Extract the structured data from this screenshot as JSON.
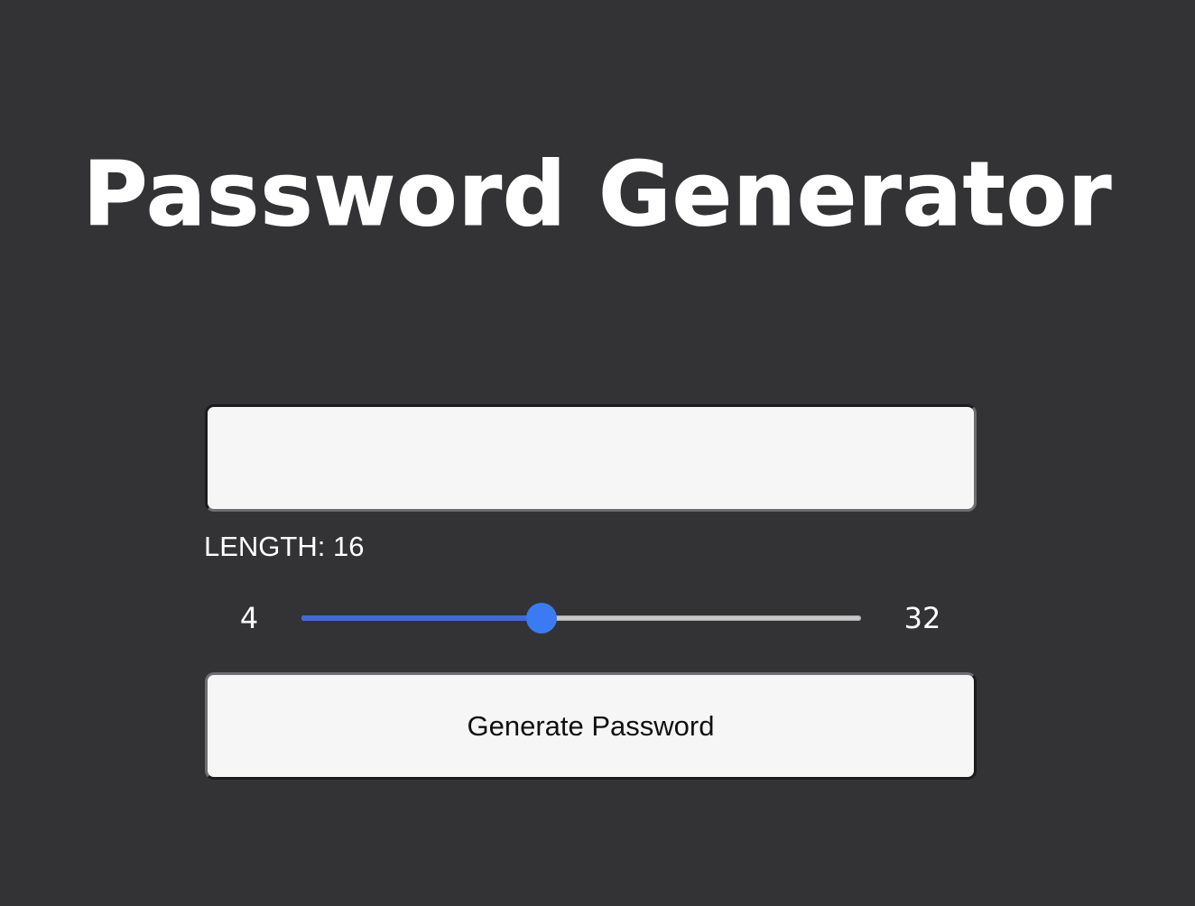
{
  "app": {
    "title": "Password Generator"
  },
  "password": {
    "value": "",
    "placeholder": ""
  },
  "length": {
    "label": "LENGTH:",
    "value": "16",
    "min": "4",
    "max": "32"
  },
  "generate_button": {
    "label": "Generate Password"
  },
  "colors": {
    "background": "#333335",
    "panel": "#f6f6f6",
    "accent": "#3a7bf2",
    "slider_fill": "#3f6ad8",
    "text_light": "#ffffff",
    "text_dark": "#111111"
  }
}
